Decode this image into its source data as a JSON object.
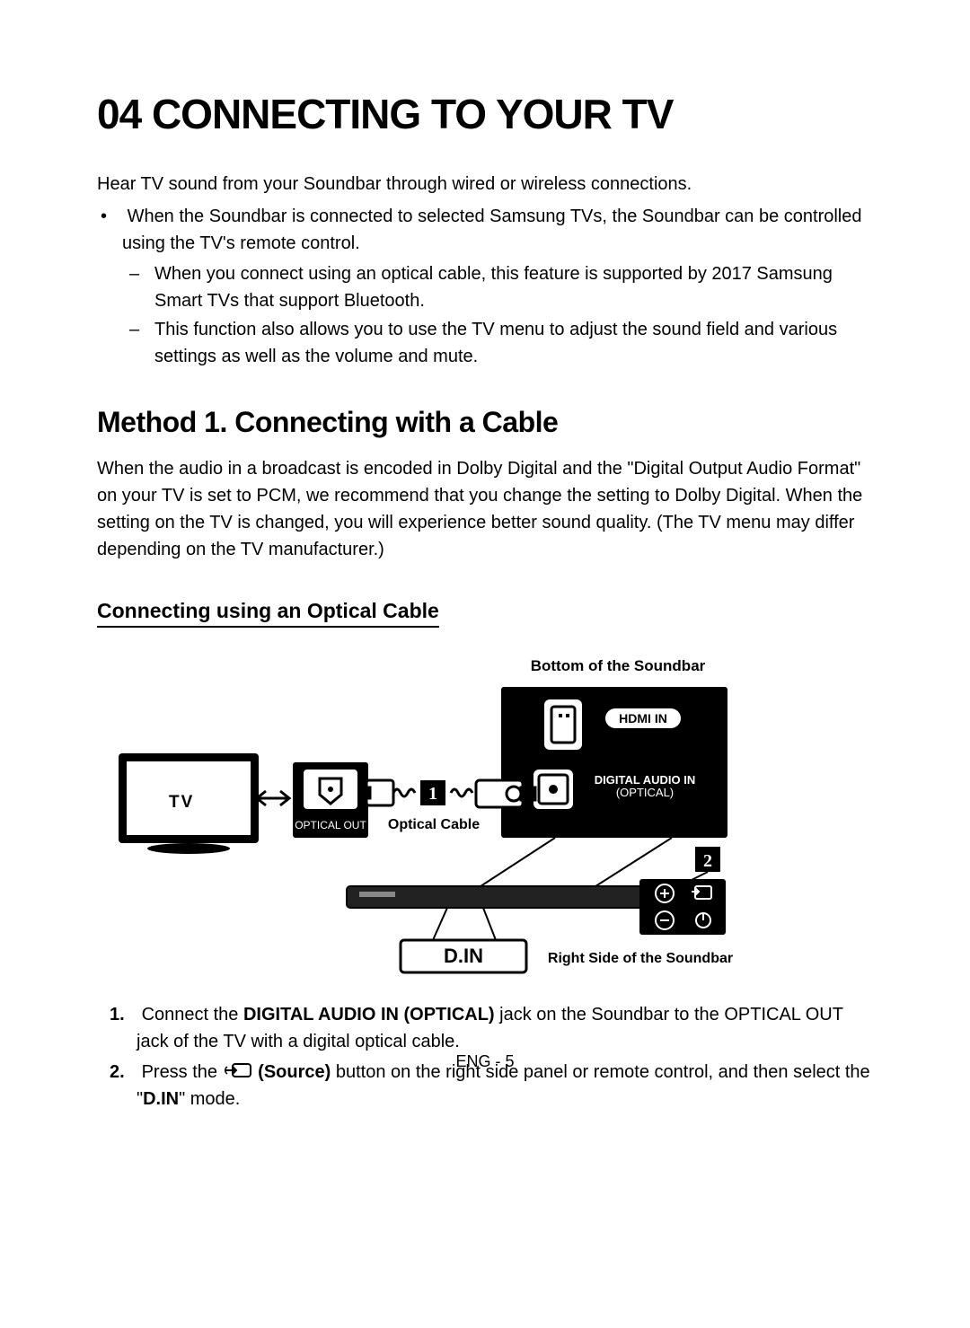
{
  "page_title": "04 CONNECTING TO YOUR TV",
  "intro": "Hear TV sound from your Soundbar through wired or wireless connections.",
  "bullet_main": "When the Soundbar is connected to selected Samsung TVs, the Soundbar can be controlled using the TV's remote control.",
  "sub1": "When you connect using an optical cable, this feature is supported by 2017 Samsung Smart TVs that support Bluetooth.",
  "sub2": "This function also allows you to use the TV menu to adjust the sound field and various settings as well as the volume and mute.",
  "method_heading": "Method 1. Connecting with a Cable",
  "method_para": "When the audio in a broadcast is encoded in Dolby Digital and the \"Digital Output Audio Format\" on your TV is set to PCM, we recommend that you change the setting to Dolby Digital. When the setting on the TV is changed, you will experience better sound quality. (The TV menu may differ depending on the TV manufacturer.)",
  "sub_heading": "Connecting using an Optical Cable",
  "diagram": {
    "top_label": "Bottom of the Soundbar",
    "tv_label": "TV",
    "optical_out": "OPTICAL OUT",
    "cable_label": "Optical Cable",
    "hdmi_in": "HDMI IN",
    "digital_audio": "DIGITAL AUDIO IN",
    "digital_audio_sub": "(OPTICAL)",
    "din": "D.IN",
    "right_side": "Right Side of the Soundbar",
    "marker1": "1",
    "marker2": "2"
  },
  "step1_a": "Connect the ",
  "step1_b": "DIGITAL AUDIO IN (OPTICAL)",
  "step1_c": " jack on the Soundbar to the OPTICAL OUT jack of the TV with a digital optical cable.",
  "step2_a": "Press the ",
  "step2_b": "(Source)",
  "step2_c": " button on the right side panel or remote control, and then select the \"",
  "step2_d": "D.IN",
  "step2_e": "\" mode.",
  "footer": "ENG - 5"
}
